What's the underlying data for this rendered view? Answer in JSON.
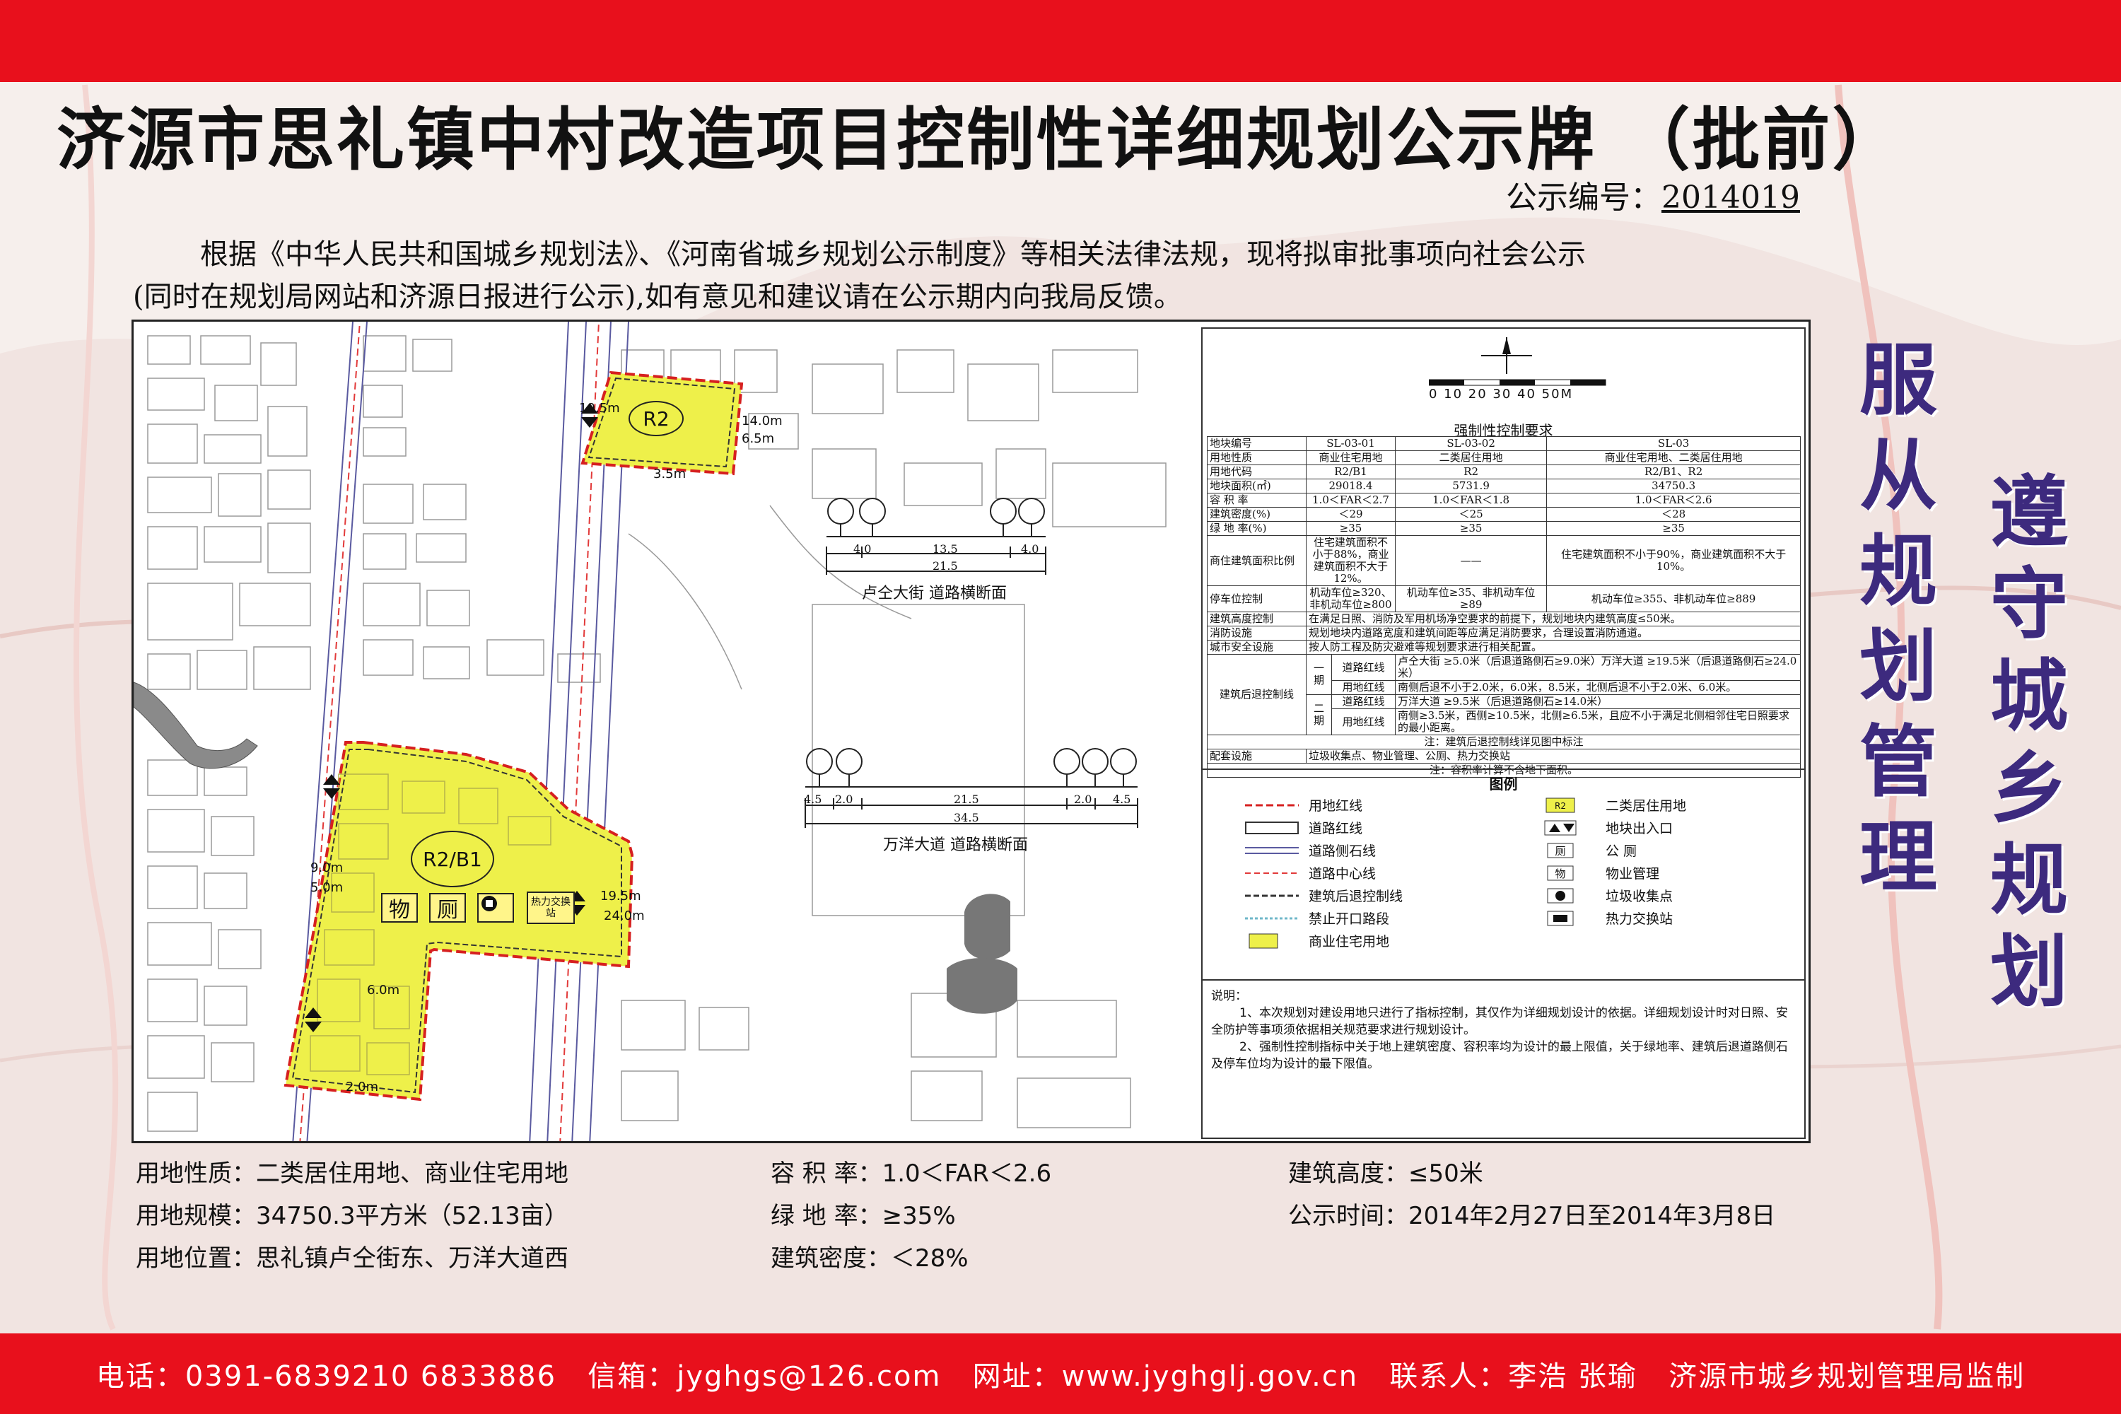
{
  "header": {
    "title": "济源市思礼镇中村改造项目控制性详细规划公示牌 （批前）",
    "notice_label": "公示编号：",
    "notice_no": "2014019"
  },
  "intro": {
    "line1": "根据《中华人民共和国城乡规划法》、《河南省城乡规划公示制度》等相关法律法规，现将拟审批事项向社会公示",
    "line2": "(同时在规划局网站和济源日报进行公示),如有意见和建议请在公示期内向我局反馈。"
  },
  "map": {
    "r2_label": "R2",
    "r2b1_label": "R2/B1",
    "icon_wu": "物",
    "icon_ce": "厕",
    "icon_heat": "热力交换站",
    "dims": {
      "d1": "10.5m",
      "d2": "14.0m",
      "d3": "3.5m",
      "d4": "6.5m",
      "d5": "9.0m",
      "d6": "5.0m",
      "d7": "19.5m",
      "d8": "24.0m",
      "d9": "6.0m",
      "d10": "2.0m"
    },
    "section1": {
      "title": "卢仝大街 道路横断面",
      "w_left": "4.0",
      "w_mid": "13.5",
      "w_right": "4.0",
      "w_total": "21.5"
    },
    "section2": {
      "title": "万洋大道 道路横断面",
      "w1": "4.5",
      "w2": "2.0",
      "w3": "21.5",
      "w4": "2.0",
      "w5": "4.5",
      "w_total": "34.5"
    },
    "scale_text": "0 10 20 30 40 50M"
  },
  "control_table": {
    "title": "强制性控制要求",
    "rows": [
      [
        "地块编号",
        "SL-03-01",
        "SL-03-02",
        "SL-03"
      ],
      [
        "用地性质",
        "商业住宅用地",
        "二类居住用地",
        "商业住宅用地、二类居住用地"
      ],
      [
        "用地代码",
        "R2/B1",
        "R2",
        "R2/B1、R2"
      ],
      [
        "地块面积(㎡)",
        "29018.4",
        "5731.9",
        "34750.3"
      ],
      [
        "容 积 率",
        "1.0＜FAR＜2.7",
        "1.0＜FAR＜1.8",
        "1.0＜FAR＜2.6"
      ],
      [
        "建筑密度(%)",
        "＜29",
        "＜25",
        "＜28"
      ],
      [
        "绿 地 率(%)",
        "≥35",
        "≥35",
        "≥35"
      ],
      [
        "商住建筑面积比例",
        "住宅建筑面积不小于88%，商业建筑面积不大于12%。",
        "——",
        "住宅建筑面积不小于90%，商业建筑面积不大于10%。"
      ],
      [
        "停车位控制",
        "机动车位≥320、非机动车位≥800",
        "机动车位≥35、非机动车位≥89",
        "机动车位≥355、非机动车位≥889"
      ]
    ],
    "height_label": "建筑高度控制",
    "height_text": "在满足日照、消防及军用机场净空要求的前提下，规划地块内建筑高度≤50米。",
    "fire_label": "消防设施",
    "fire_text": "规划地块内道路宽度和建筑间距等应满足消防要求，合理设置消防通道。",
    "safety_label": "城市安全设施",
    "safety_text": "按人防工程及防灾避难等规划要求进行相关配置。",
    "setback_label": "建筑后退控制线",
    "phase1": "一期",
    "phase2": "二期",
    "road_red": "道路红线",
    "land_red": "用地红线",
    "p1_road": "卢仝大街 ≥5.0米（后退道路侧石≥9.0米）万洋大道 ≥19.5米（后退道路侧石≥24.0米）",
    "p1_land": "南侧后退不小于2.0米，6.0米，8.5米，北侧后退不小于2.0米、6.0米。",
    "p2_road": "万洋大道 ≥9.5米（后退道路侧石≥14.0米）",
    "p2_land": "南侧≥3.5米，西侧≥10.5米，北侧≥6.5米，且应不小于满足北侧相邻住宅日照要求的最小距离。",
    "setback_note": "注：建筑后退控制线详见图中标注",
    "facility_label": "配套设施",
    "facility_text": "垃圾收集点、物业管理、公厕、热力交换站",
    "facility_note": "注：容积率计算不含地下面积。"
  },
  "legend": {
    "title": "图例",
    "items_left": [
      "用地红线",
      "道路红线",
      "道路侧石线",
      "道路中心线",
      "建筑后退控制线",
      "禁止开口路段",
      "商业住宅用地"
    ],
    "items_right": [
      "二类居住用地",
      "地块出入口",
      "公 厕",
      "物业管理",
      "垃圾收集点",
      "热力交换站"
    ],
    "sym_r2": "R2",
    "sym_ce": "厕",
    "sym_wu": "物"
  },
  "notes": {
    "heading": "说明：",
    "n1": "1、本次规划对建设用地只进行了指标控制，其仅作为详细规划设计的依据。详细规划设计时对日照、安全防护等事项须依据相关规范要求进行规划设计。",
    "n2": "2、强制性控制指标中关于地上建筑密度、容积率均为设计的最上限值，关于绿地率、建筑后退道路侧石及停车位均为设计的最下限值。"
  },
  "slogans": {
    "left": "服从规划管理",
    "right": "遵守城乡规划"
  },
  "summary": {
    "land_use": "用地性质：二类居住用地、商业住宅用地",
    "land_size": "用地规模：34750.3平方米（52.13亩）",
    "land_loc": "用地位置：思礼镇卢仝街东、万洋大道西",
    "far": "容  积  率：1.0＜FAR＜2.6",
    "green": "绿  地  率：≥35%",
    "density": "建筑密度：＜28%",
    "height": "建筑高度：≤50米",
    "period": "公示时间：2014年2月27日至2014年3月8日"
  },
  "footer": {
    "text": "电话：0391-6839210 6833886   信箱：jyghgs@126.com   网址：www.jyghglj.gov.cn   联系人：李浩 张瑜   济源市城乡规划管理局监制"
  },
  "colors": {
    "banner_red": "#e8101c",
    "plot_yellow": "#eef04a",
    "slogan_purple": "#3d2a7e"
  }
}
